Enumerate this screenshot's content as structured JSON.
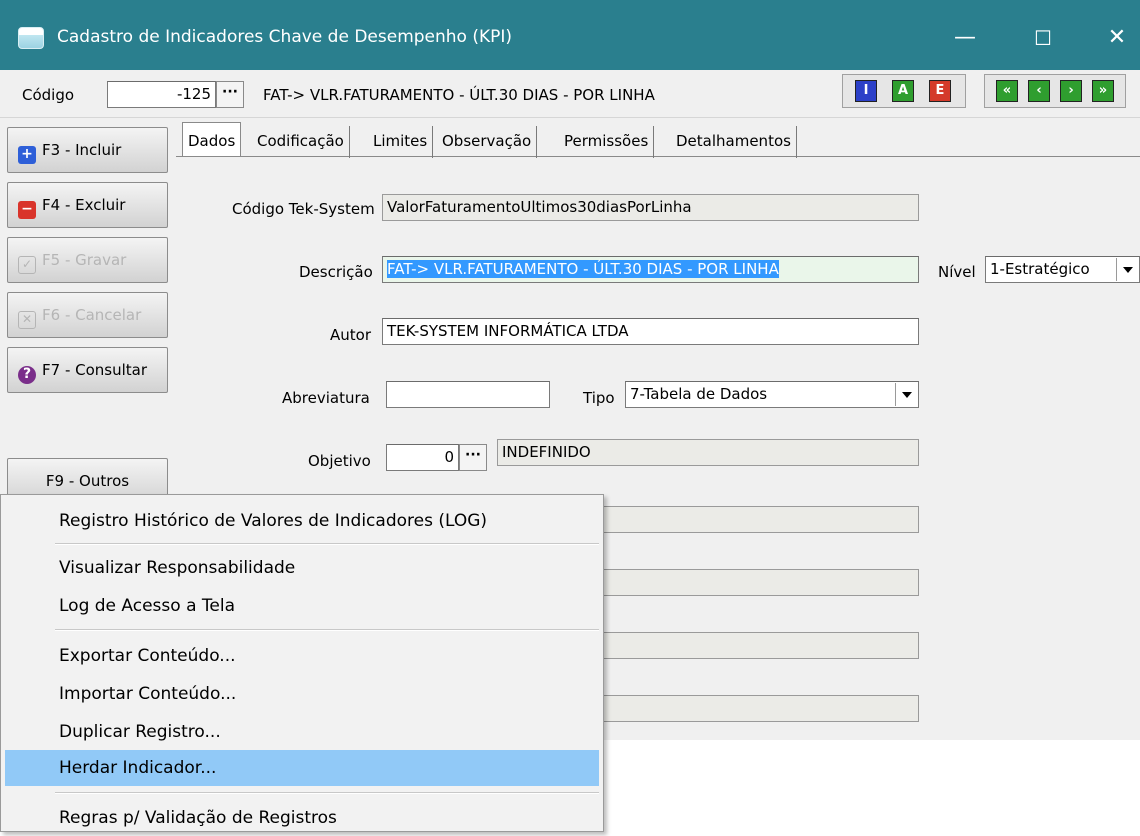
{
  "window": {
    "title": "Cadastro de Indicadores Chave de Desempenho (KPI)",
    "minimize": "—",
    "maximize": "☐",
    "close": "✕"
  },
  "toolbar": {
    "codigo_label": "Código",
    "codigo_value": "-125",
    "lookup_label": "···",
    "record_description": "FAT-> VLR.FATURAMENTO - ÚLT.30 DIAS - POR LINHA",
    "mode_buttons": [
      "I",
      "A",
      "E"
    ],
    "nav_buttons": [
      "«",
      "‹",
      "›",
      "»"
    ]
  },
  "left_buttons": {
    "incluir": "F3 - Incluir",
    "excluir": "F4 - Excluir",
    "gravar": "F5 - Gravar",
    "cancelar": "F6 - Cancelar",
    "consultar": "F7 - Consultar",
    "outros": "F9 - Outros"
  },
  "tabs": [
    "Dados",
    "Codificação",
    "Limites",
    "Observação",
    "Permissões",
    "Detalhamentos"
  ],
  "form": {
    "codigo_tek_label": "Código Tek-System",
    "codigo_tek_value": "ValorFaturamentoUltimos30diasPorLinha",
    "descricao_label": "Descrição",
    "descricao_value": "FAT-> VLR.FATURAMENTO - ÚLT.30 DIAS - POR LINHA",
    "nivel_label": "Nível",
    "nivel_value": "1-Estratégico",
    "autor_label": "Autor",
    "autor_value": "TEK-SYSTEM INFORMÁTICA LTDA",
    "abreviatura_label": "Abreviatura",
    "abreviatura_value": "",
    "tipo_label": "Tipo",
    "tipo_value": "7-Tabela de Dados",
    "objetivo_label": "Objetivo",
    "objetivo_value": "0",
    "objetivo_desc": "INDEFINIDO"
  },
  "menu": {
    "items": [
      "Registro Histórico de Valores de Indicadores (LOG)",
      "Visualizar Responsabilidade",
      "Log de Acesso a Tela",
      "Exportar Conteúdo...",
      "Importar Conteúdo...",
      "Duplicar Registro...",
      "Herdar Indicador...",
      "Regras p/ Validação de Registros"
    ],
    "highlighted": "Herdar Indicador..."
  },
  "colors": {
    "titlebar": "#2a7f8e",
    "menu_highlight": "#91c9f7",
    "selection": "#3399ff"
  }
}
